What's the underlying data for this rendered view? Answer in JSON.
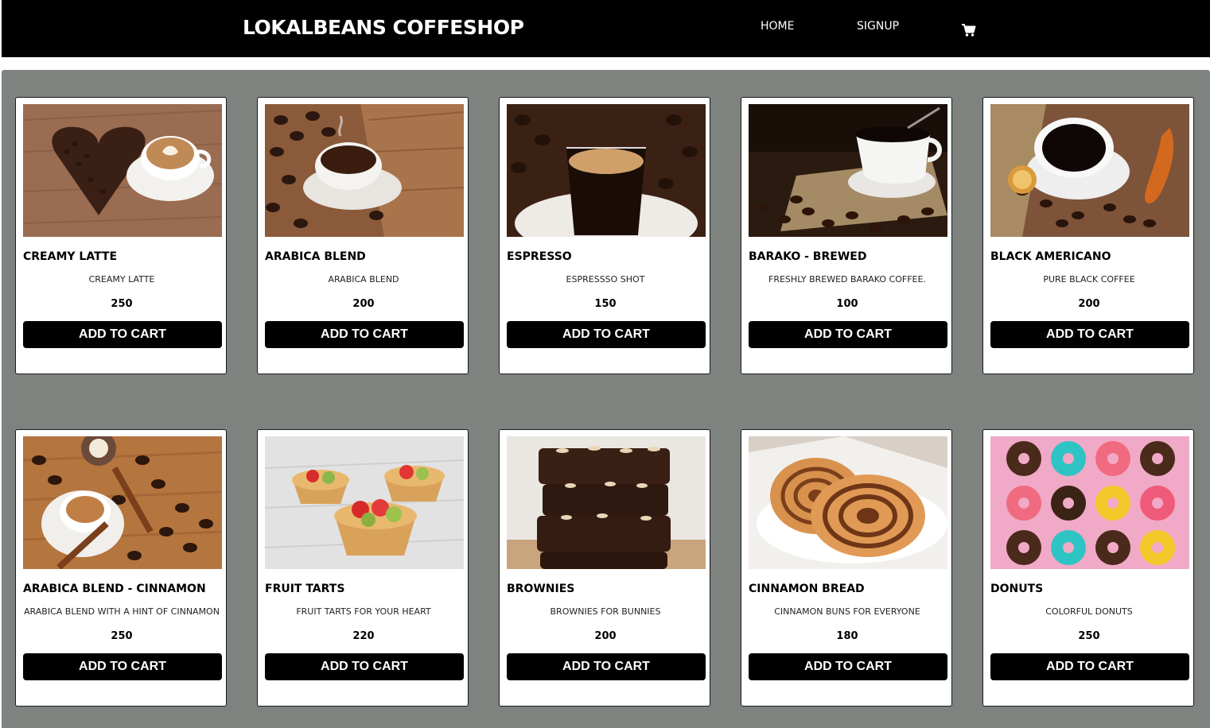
{
  "navbar": {
    "brand": "LOKALBEANS COFFESHOP",
    "home_label": "HOME",
    "signup_label": "SIGNUP",
    "cart_icon": "cart-icon"
  },
  "colors": {
    "navbar_bg": "#000000",
    "main_bg": "#7e8380",
    "button_bg": "#000000",
    "card_bg": "#ffffff"
  },
  "products": [
    {
      "name": "CREAMY LATTE",
      "description": "CREAMY LATTE",
      "price": "250",
      "button_label": "ADD TO CART",
      "image": "latte-photo"
    },
    {
      "name": "ARABICA BLEND",
      "description": "ARABICA BLEND",
      "price": "200",
      "button_label": "ADD TO CART",
      "image": "arabica-photo"
    },
    {
      "name": "ESPRESSO",
      "description": "ESPRESSSO SHOT",
      "price": "150",
      "button_label": "ADD TO CART",
      "image": "espresso-photo"
    },
    {
      "name": "BARAKO - BREWED",
      "description": "FRESHLY BREWED BARAKO COFFEE.",
      "price": "100",
      "button_label": "ADD TO CART",
      "image": "barako-photo"
    },
    {
      "name": "BLACK AMERICANO",
      "description": "PURE BLACK COFFEE",
      "price": "200",
      "button_label": "ADD TO CART",
      "image": "americano-photo"
    },
    {
      "name": "ARABICA BLEND - CINNAMON",
      "description": "ARABICA BLEND WITH A HINT OF CINNAMON",
      "price": "250",
      "button_label": "ADD TO CART",
      "image": "cinnamon-coffee-photo"
    },
    {
      "name": "FRUIT TARTS",
      "description": "FRUIT TARTS FOR YOUR HEART",
      "price": "220",
      "button_label": "ADD TO CART",
      "image": "fruit-tarts-photo"
    },
    {
      "name": "BROWNIES",
      "description": "BROWNIES FOR BUNNIES",
      "price": "200",
      "button_label": "ADD TO CART",
      "image": "brownies-photo"
    },
    {
      "name": "CINNAMON BREAD",
      "description": "CINNAMON BUNS FOR EVERYONE",
      "price": "180",
      "button_label": "ADD TO CART",
      "image": "cinnamon-bread-photo"
    },
    {
      "name": "DONUTS",
      "description": "COLORFUL DONUTS",
      "price": "250",
      "button_label": "ADD TO CART",
      "image": "donuts-photo"
    }
  ]
}
